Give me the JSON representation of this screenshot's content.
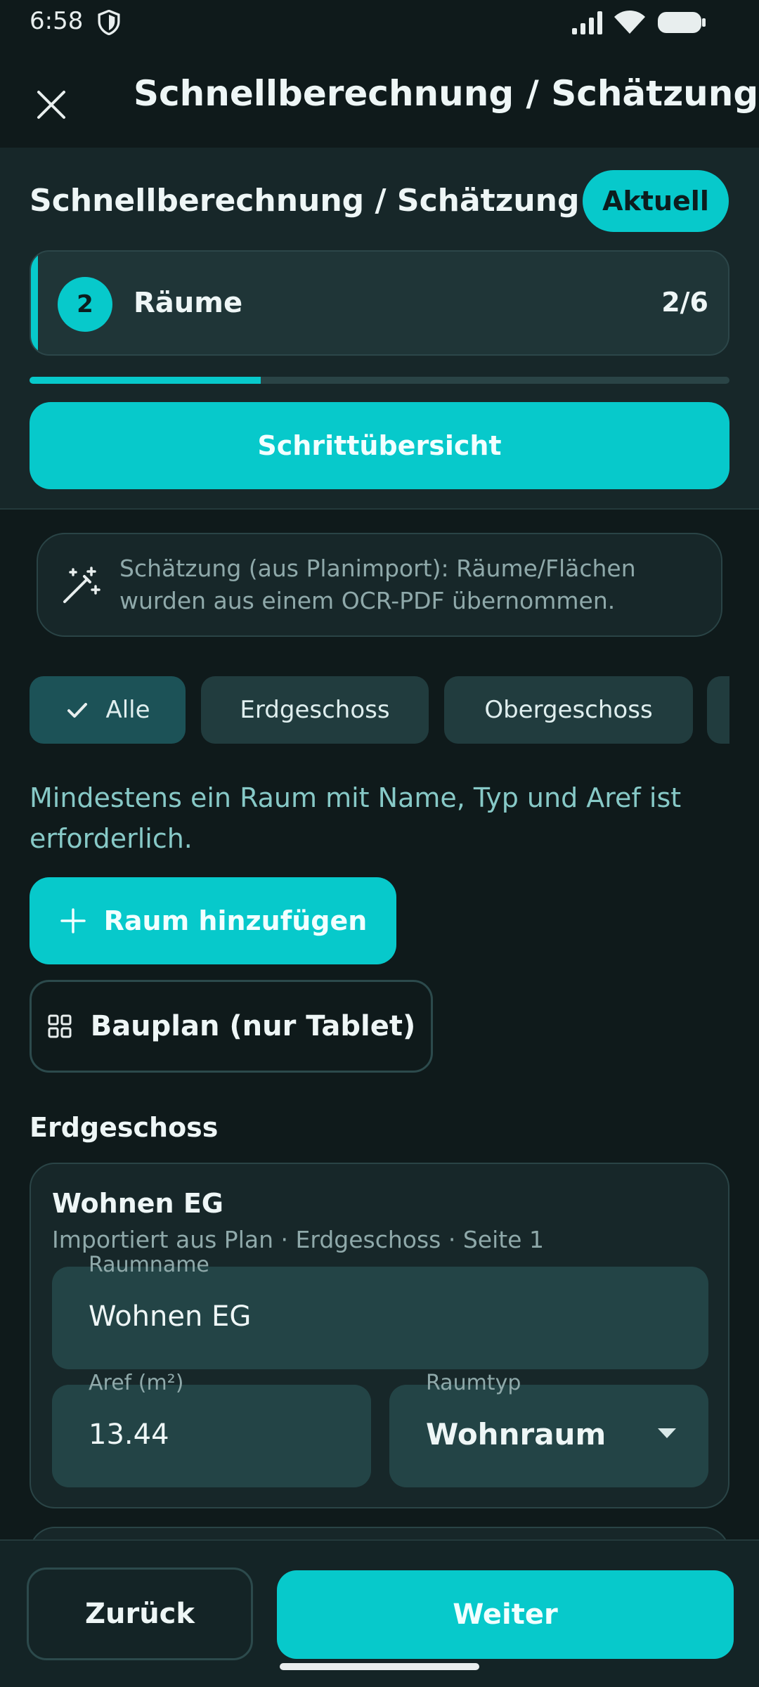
{
  "status_bar": {
    "time": "6:58"
  },
  "app_bar": {
    "title": "Schnellberechnung / Schätzung"
  },
  "header": {
    "title": "Schnellberechnung / Schätzung",
    "badge": "Aktuell",
    "step": {
      "number": "2",
      "name": "Räume",
      "count": "2/6"
    },
    "progress": 0.33,
    "overview_button": "Schrittübersicht"
  },
  "info": {
    "icon": "magic-wand-icon",
    "text": "Schätzung (aus Planimport): Räume/Flächen wurden aus einem OCR-PDF übernommen."
  },
  "filters": {
    "chips": [
      {
        "label": "Alle",
        "selected": true
      },
      {
        "label": "Erdgeschoss",
        "selected": false
      },
      {
        "label": "Obergeschoss",
        "selected": false
      },
      {
        "label": "",
        "selected": false
      }
    ]
  },
  "hint": "Mindestens ein Raum mit Name, Typ und Aref ist erforderlich.",
  "actions": {
    "add_room": "Raum hinzufügen",
    "floor_plan": "Bauplan (nur Tablet)"
  },
  "section": {
    "title": "Erdgeschoss"
  },
  "room": {
    "title": "Wohnen EG",
    "subtitle": "Importiert aus Plan · Erdgeschoss · Seite 1",
    "name_label": "Raumname",
    "name_value": "Wohnen EG",
    "aref_label": "Aref (m²)",
    "aref_value": "13.44",
    "type_label": "Raumtyp",
    "type_value": "Wohnraum"
  },
  "bottom": {
    "back": "Zurück",
    "next": "Weiter"
  },
  "colors": {
    "accent": "#07c9cb",
    "background": "#0f1a1b",
    "surface": "#172729"
  }
}
